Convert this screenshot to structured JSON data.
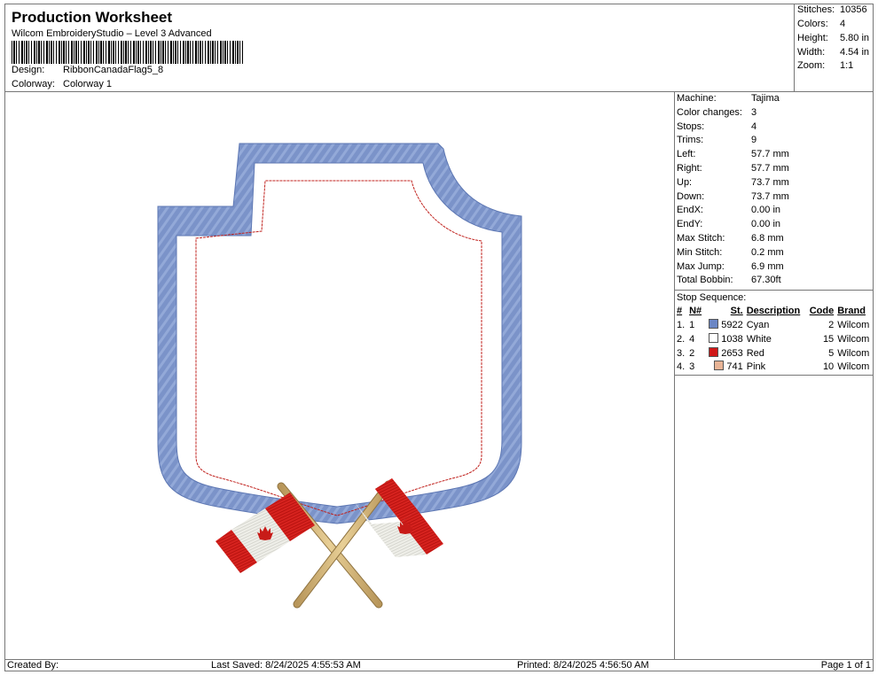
{
  "header": {
    "title": "Production Worksheet",
    "subtitle": "Wilcom EmbroideryStudio – Level 3 Advanced",
    "design_label": "Design:",
    "design_value": "RibbonCanadaFlag5_8",
    "colorway_label": "Colorway:",
    "colorway_value": "Colorway 1"
  },
  "stats": [
    {
      "label": "Stitches:",
      "value": "10356"
    },
    {
      "label": "Colors:",
      "value": "4"
    },
    {
      "label": "Height:",
      "value": "5.80 in"
    },
    {
      "label": "Width:",
      "value": "4.54 in"
    },
    {
      "label": "Zoom:",
      "value": "1:1"
    }
  ],
  "machine_info": [
    {
      "label": "Machine:",
      "value": "Tajima"
    },
    {
      "label": "Color changes:",
      "value": "3"
    },
    {
      "label": "Stops:",
      "value": "4"
    },
    {
      "label": "Trims:",
      "value": "9"
    },
    {
      "label": "Left:",
      "value": "57.7 mm"
    },
    {
      "label": "Right:",
      "value": "57.7 mm"
    },
    {
      "label": "Up:",
      "value": "73.7 mm"
    },
    {
      "label": "Down:",
      "value": "73.7 mm"
    },
    {
      "label": "EndX:",
      "value": "0.00 in"
    },
    {
      "label": "EndY:",
      "value": "0.00 in"
    },
    {
      "label": "Max Stitch:",
      "value": "6.8 mm"
    },
    {
      "label": "Min Stitch:",
      "value": "0.2 mm"
    },
    {
      "label": "Max Jump:",
      "value": "6.9 mm"
    },
    {
      "label": "Total Bobbin:",
      "value": "67.30ft"
    }
  ],
  "stop_sequence": {
    "label": "Stop Sequence:",
    "columns": {
      "num": "#",
      "n": "N#",
      "st": "St.",
      "desc": "Description",
      "code": "Code",
      "brand": "Brand"
    },
    "rows": [
      {
        "num": "1.",
        "n": "1",
        "color": "#6b86c4",
        "st": "5922",
        "desc": "Cyan",
        "code": "2",
        "brand": "Wilcom"
      },
      {
        "num": "2.",
        "n": "4",
        "color": "#ffffff",
        "st": "1038",
        "desc": "White",
        "code": "15",
        "brand": "Wilcom"
      },
      {
        "num": "3.",
        "n": "2",
        "color": "#d01818",
        "st": "2653",
        "desc": "Red",
        "code": "5",
        "brand": "Wilcom"
      },
      {
        "num": "4.",
        "n": "3",
        "color": "#e8b496",
        "st": "741",
        "desc": "Pink",
        "code": "10",
        "brand": "Wilcom"
      }
    ]
  },
  "footer": {
    "created": "Created By:",
    "saved": "Last Saved: 8/24/2025 4:55:53 AM",
    "printed": "Printed: 8/24/2025 4:56:50 AM",
    "page": "Page 1 of 1"
  }
}
